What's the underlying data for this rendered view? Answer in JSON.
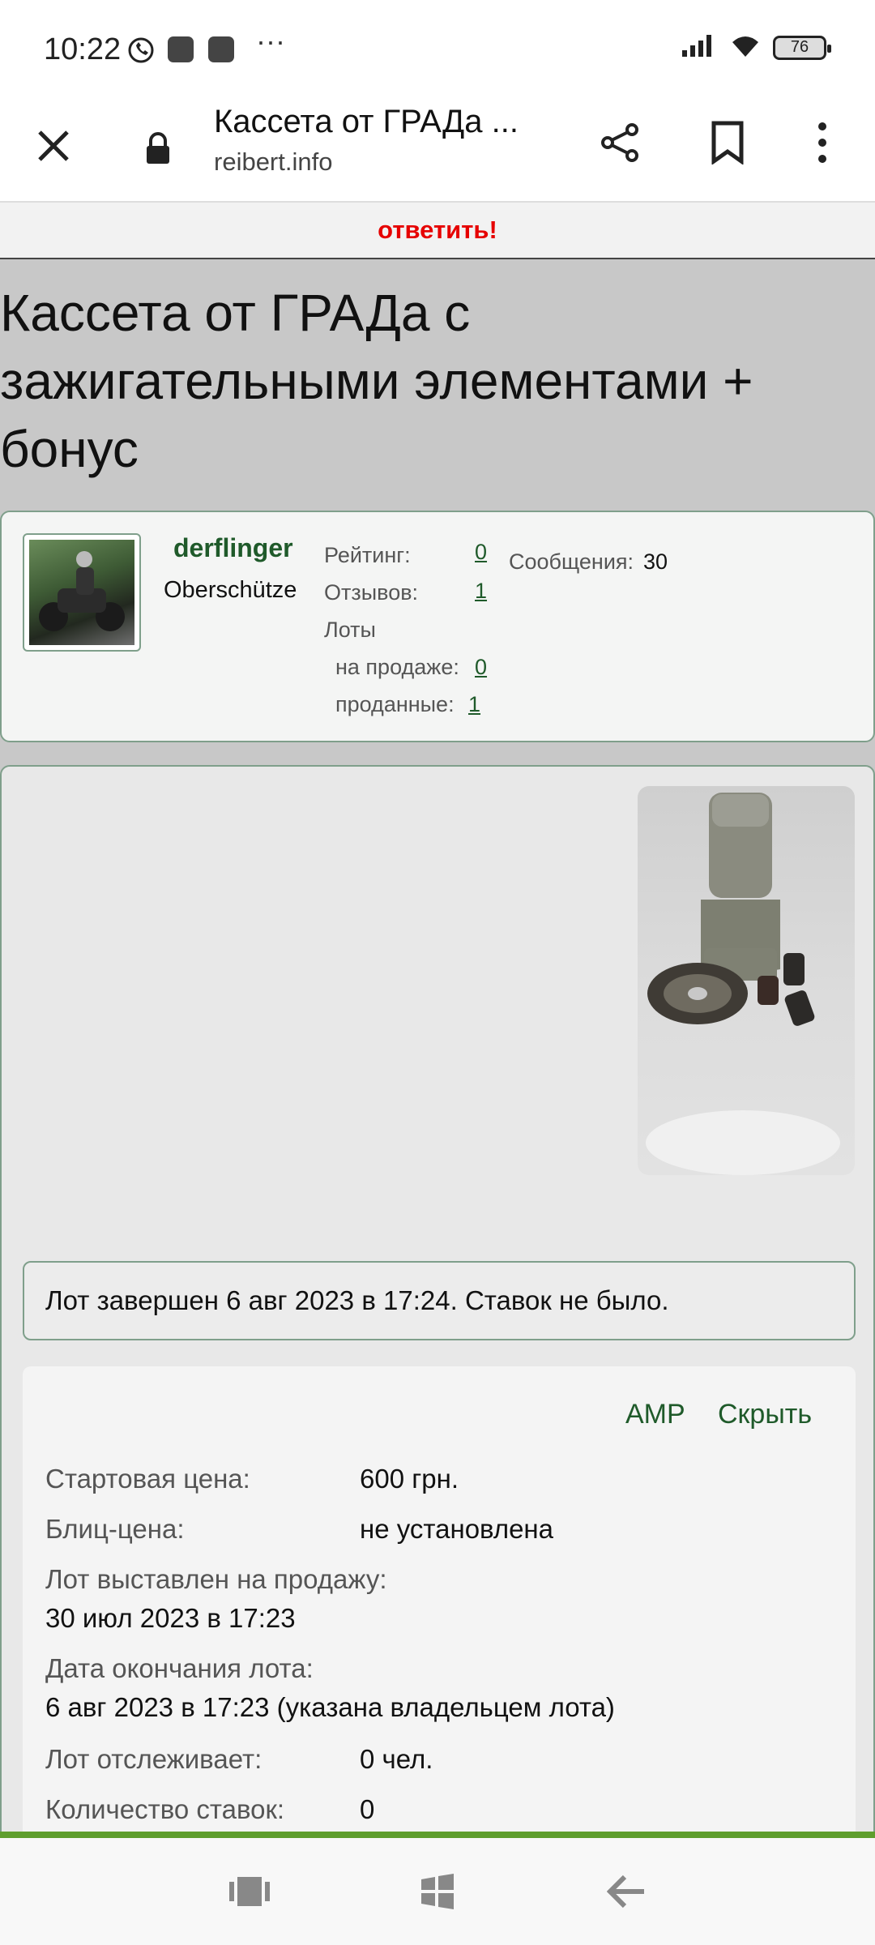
{
  "status_bar": {
    "time": "10:22",
    "battery": "76",
    "icons": [
      "viber-icon",
      "app-notification-icon",
      "app-notification-icon",
      "more-notifications-icon",
      "signal-icon",
      "wifi-icon",
      "battery-icon"
    ],
    "more": "···"
  },
  "browser": {
    "title": "Кассета от ГРАДа ...",
    "url": "reibert.info",
    "icons": [
      "close-icon",
      "lock-icon",
      "share-icon",
      "bookmark-icon",
      "overflow-menu-icon"
    ]
  },
  "page": {
    "reply_link": "ответить!",
    "post_title": "Кассета от ГРАДа с зажигательными элементами + бонус",
    "user": {
      "name": "derflinger",
      "rank": "Oberschütze",
      "rating_label": "Рейтинг:",
      "rating_value": "0",
      "reviews_label": "Отзывов:",
      "reviews_value": "1",
      "lots_label": "Лоты",
      "on_sale_label": "на продаже:",
      "on_sale_value": "0",
      "sold_label": "проданные:",
      "sold_value": "1",
      "messages_label": "Сообщения:",
      "messages_value": "30"
    },
    "lot_status": "Лот завершен 6 авг 2023 в 17:24. Ставок не было.",
    "details": {
      "amp_link": "AMP",
      "hide_link": "Скрыть",
      "start_price_label": "Стартовая цена:",
      "start_price_value": "600 грн.",
      "blitz_price_label": "Блиц-цена:",
      "blitz_price_value": "не установлена",
      "listed_label": "Лот выставлен на продажу:",
      "listed_value": "30 июл 2023 в 17:23",
      "end_date_label": "Дата окончания лота:",
      "end_date_value": "6 авг 2023 в 17:23 (указана владельцем лота)",
      "watchers_label": "Лот отслеживает:",
      "watchers_value": "0 чел.",
      "bids_label": "Количество ставок:",
      "bids_value": "0"
    }
  },
  "nav_bar": {
    "icons": [
      "recent-apps-icon",
      "home-icon",
      "back-icon"
    ]
  },
  "colors": {
    "reply": "#e60000",
    "link_green": "#1f5a2a",
    "border_green": "#7f9f8b",
    "accent_green": "#5f9e2e",
    "page_gray": "#c8c8c8"
  }
}
